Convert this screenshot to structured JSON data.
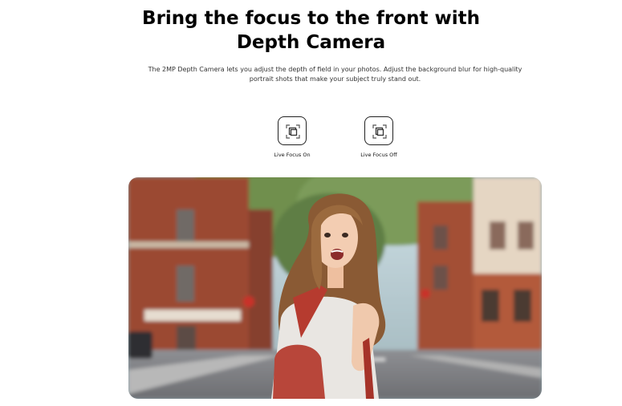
{
  "headline": "Bring the focus to the front with Depth Camera",
  "description": "The 2MP Depth Camera lets you adjust the depth of field in your photos. Adjust the background blur for high-quality portrait shots that make your subject truly stand out.",
  "toggles": [
    {
      "label": "Live Focus On",
      "icon": "live-focus-icon"
    },
    {
      "label": "Live Focus Off",
      "icon": "live-focus-icon"
    }
  ],
  "photo": {
    "subject": "portrait-photo"
  }
}
